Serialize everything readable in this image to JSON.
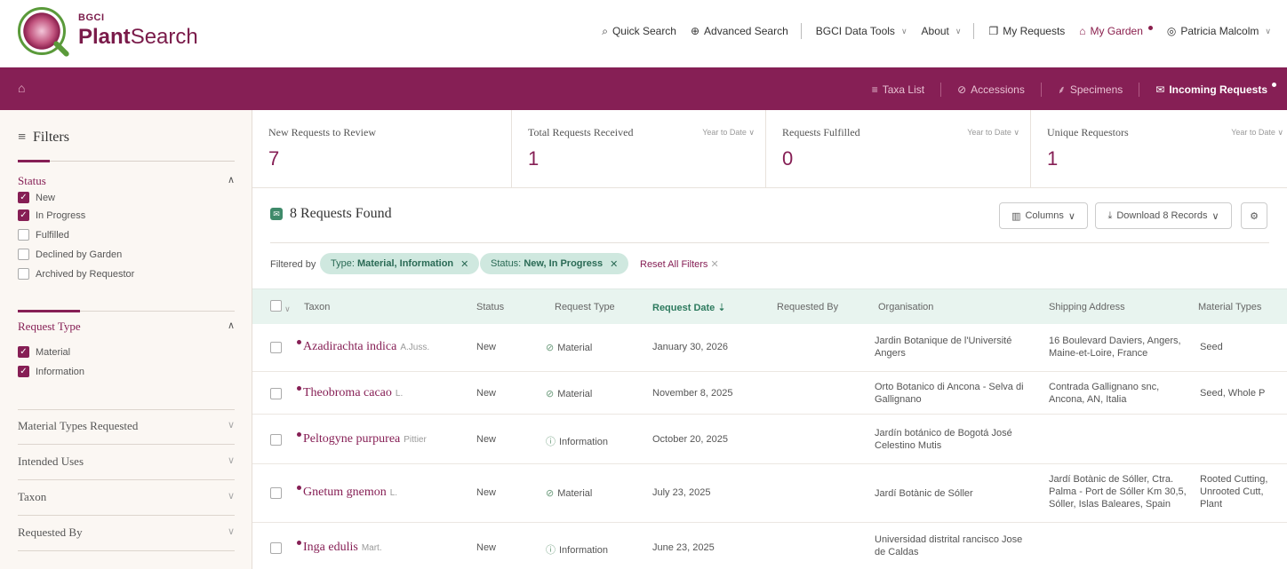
{
  "header": {
    "logo_top": "BGCI",
    "logo_bold": "Plant",
    "logo_rest": "Search",
    "nav": {
      "quick_search": "Quick Search",
      "advanced_search": "Advanced Search",
      "data_tools": "BGCI Data Tools",
      "about": "About",
      "my_requests": "My Requests",
      "my_garden": "My Garden",
      "user": "Patricia Malcolm"
    }
  },
  "subnav": {
    "taxa_list": "Taxa List",
    "accessions": "Accessions",
    "specimens": "Specimens",
    "incoming_requests": "Incoming Requests"
  },
  "sidebar": {
    "title": "Filters",
    "status": {
      "label": "Status",
      "options": [
        {
          "label": "New",
          "checked": true
        },
        {
          "label": "In Progress",
          "checked": true
        },
        {
          "label": "Fulfilled",
          "checked": false
        },
        {
          "label": "Declined by Garden",
          "checked": false
        },
        {
          "label": "Archived by Requestor",
          "checked": false
        }
      ]
    },
    "request_type": {
      "label": "Request Type",
      "options": [
        {
          "label": "Material",
          "checked": true
        },
        {
          "label": "Information",
          "checked": true
        }
      ]
    },
    "collapsed": [
      "Material Types Requested",
      "Intended Uses",
      "Taxon",
      "Requested By"
    ]
  },
  "stats": [
    {
      "label": "New Requests to Review",
      "range": "",
      "value": "7"
    },
    {
      "label": "Total Requests Received",
      "range": "Year to Date",
      "value": "1"
    },
    {
      "label": "Requests Fulfilled",
      "range": "Year to Date",
      "value": "0"
    },
    {
      "label": "Unique Requestors",
      "range": "Year to Date",
      "value": "1"
    }
  ],
  "results": {
    "found": "8 Requests Found",
    "columns_btn": "Columns",
    "download_btn": "Download 8 Records",
    "filtered_by": "Filtered by",
    "chip1_prefix": "Type:",
    "chip1_value": "Material, Information",
    "chip2_prefix": "Status:",
    "chip2_value": "New, In Progress",
    "reset": "Reset All Filters"
  },
  "table": {
    "headers": {
      "taxon": "Taxon",
      "status": "Status",
      "request_type": "Request Type",
      "request_date": "Request Date",
      "requested_by": "Requested By",
      "organisation": "Organisation",
      "shipping_address": "Shipping Address",
      "material_types": "Material Types"
    },
    "rows": [
      {
        "taxon": "Azadirachta indica",
        "author": "A.Juss.",
        "status": "New",
        "type": "Material",
        "date": "January 30, 2026",
        "requested_by": "",
        "org": "Jardin Botanique de l'Université Angers",
        "address": "16 Boulevard Daviers, Angers, Maine-et-Loire, France",
        "material": "Seed"
      },
      {
        "taxon": "Theobroma cacao",
        "author": "L.",
        "status": "New",
        "type": "Material",
        "date": "November 8, 2025",
        "requested_by": "",
        "org": "Orto Botanico di Ancona - Selva di Gallignano",
        "address": "Contrada Gallignano snc, Ancona, AN, Italia",
        "material": "Seed, Whole P"
      },
      {
        "taxon": "Peltogyne purpurea",
        "author": "Pittier",
        "status": "New",
        "type": "Information",
        "date": "October 20, 2025",
        "requested_by": "",
        "org": "Jardín botánico de Bogotá José Celestino Mutis",
        "address": "",
        "material": ""
      },
      {
        "taxon": "Gnetum gnemon",
        "author": "L.",
        "status": "New",
        "type": "Material",
        "date": "July 23, 2025",
        "requested_by": "",
        "org": "Jardí Botànic de Sóller",
        "address": "Jardí Botànic de Sóller, Ctra. Palma - Port de Sóller Km 30,5, Sóller, Islas Baleares, Spain",
        "material": "Rooted Cutting, Unrooted Cutt, Plant"
      },
      {
        "taxon": "Inga edulis",
        "author": "Mart.",
        "status": "New",
        "type": "Information",
        "date": "June 23, 2025",
        "requested_by": "",
        "org": "Universidad distrital rancisco Jose de Caldas",
        "address": "",
        "material": ""
      }
    ]
  },
  "colors": {
    "brand": "#861f55",
    "accent_green": "#2d7a5e",
    "chip_bg": "#cfe8df"
  }
}
